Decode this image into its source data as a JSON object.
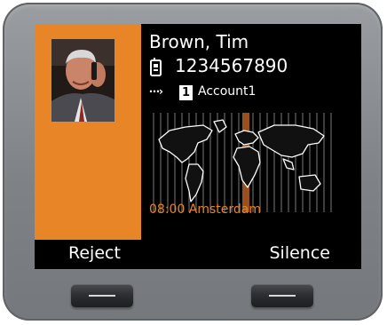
{
  "caller": {
    "name": "Brown, Tim",
    "number": "1234567890",
    "phone_icon": "mobile-phone-icon",
    "photo": "caller-photo"
  },
  "account": {
    "direction_icon": "incoming-arrow-icon",
    "badge": "1",
    "name": "Account1"
  },
  "world_clock": {
    "time_label": "08:00 Amsterdam",
    "map": "world-map"
  },
  "softkeys": {
    "left_label": "Reject",
    "right_label": "Silence"
  },
  "hardware_buttons": {
    "left": "left-softkey-button",
    "right": "right-softkey-button"
  },
  "colors": {
    "accent": "#e88526",
    "screen_bg": "#000000",
    "text": "#ffffff",
    "bezel": "#8a8d91"
  }
}
